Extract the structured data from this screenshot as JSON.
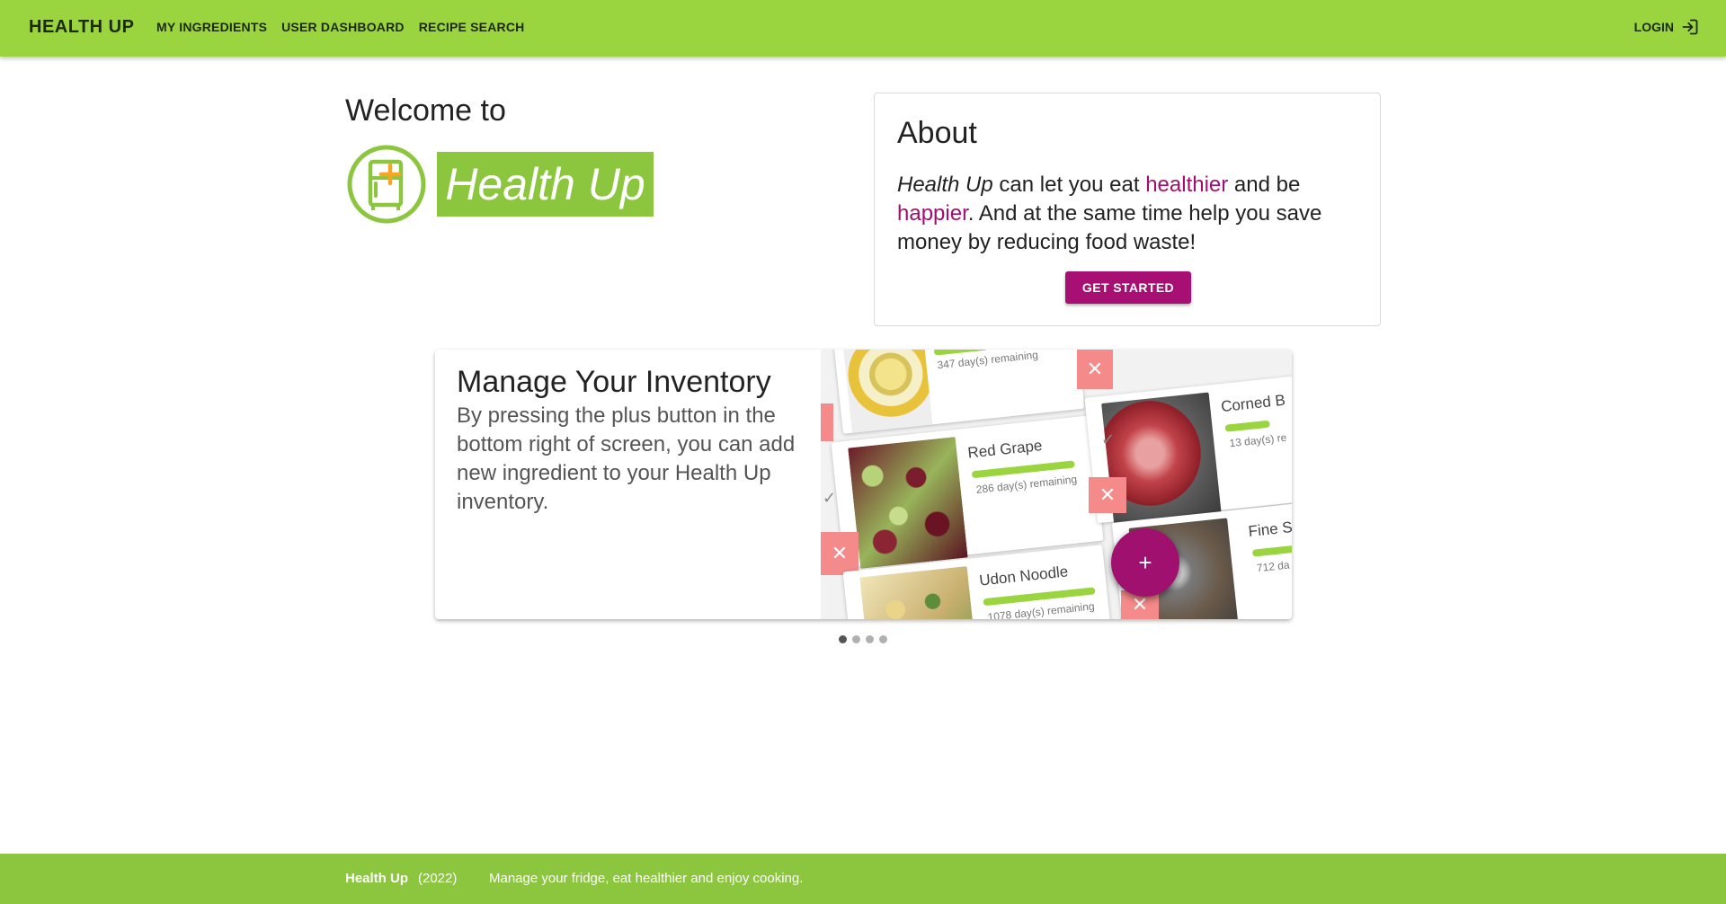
{
  "header": {
    "brand": "HEALTH UP",
    "nav": [
      "MY INGREDIENTS",
      "USER DASHBOARD",
      "RECIPE SEARCH"
    ],
    "login_label": "LOGIN",
    "bg_color": "#9ad43f"
  },
  "hero": {
    "welcome": "Welcome to",
    "logo_text": "Health Up"
  },
  "about": {
    "title": "About",
    "brand_name": "Health Up",
    "text_1": " can let you eat ",
    "word_healthier": "healthier",
    "text_2": " and be ",
    "word_happier": "happier",
    "text_3": ". And at the same time help you save money by reducing food waste!",
    "button": "GET STARTED",
    "accent_color": "#a0106e"
  },
  "carousel": {
    "title": "Manage Your Inventory",
    "text": "By pressing the plus button in the bottom right of screen, you can add new ingredient to your Health Up inventory.",
    "active_index": 0,
    "slide_count": 4,
    "items": [
      {
        "name": "",
        "remaining": "347 day(s) remaining"
      },
      {
        "name": "Red Grape",
        "remaining": "286 day(s) remaining"
      },
      {
        "name": "Udon Noodle",
        "remaining": "1078 day(s) remaining"
      },
      {
        "name": "Corned B",
        "remaining": "13 day(s) re"
      },
      {
        "name": "Fine S",
        "remaining": "712 da"
      }
    ],
    "fab_symbol": "+"
  },
  "footer": {
    "brand": "Health Up",
    "year": "(2022)",
    "tagline": "Manage your fridge, eat healthier and enjoy cooking.",
    "bg_color": "#8cc63f"
  }
}
